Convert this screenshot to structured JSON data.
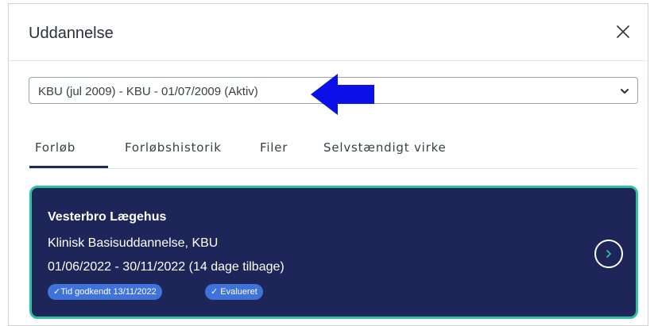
{
  "dialog": {
    "title": "Uddannelse",
    "close_icon": "close-icon"
  },
  "select": {
    "value": "KBU (jul 2009) - KBU - 01/07/2009 (Aktiv)",
    "icon": "chevron-down-icon"
  },
  "annotation": {
    "icon": "arrow-left-icon",
    "color": "#0a10e6"
  },
  "tabs": [
    {
      "label": "Forløb",
      "active": true
    },
    {
      "label": "Forløbshistorik",
      "active": false
    },
    {
      "label": "Filer",
      "active": false
    },
    {
      "label": "Selvstændigt virke",
      "active": false
    }
  ],
  "card": {
    "title": "Vesterbro Lægehus",
    "subtitle": "Klinisk Basisuddannelse, KBU",
    "period": "01/06/2022 - 30/11/2022  (14 dage tilbage)",
    "badges": [
      "✓Tid godkendt 13/11/2022",
      "✓ Evalueret"
    ],
    "open_icon": "chevron-right-circle-icon",
    "background": "#1e2659",
    "border": "#2fc29f"
  }
}
